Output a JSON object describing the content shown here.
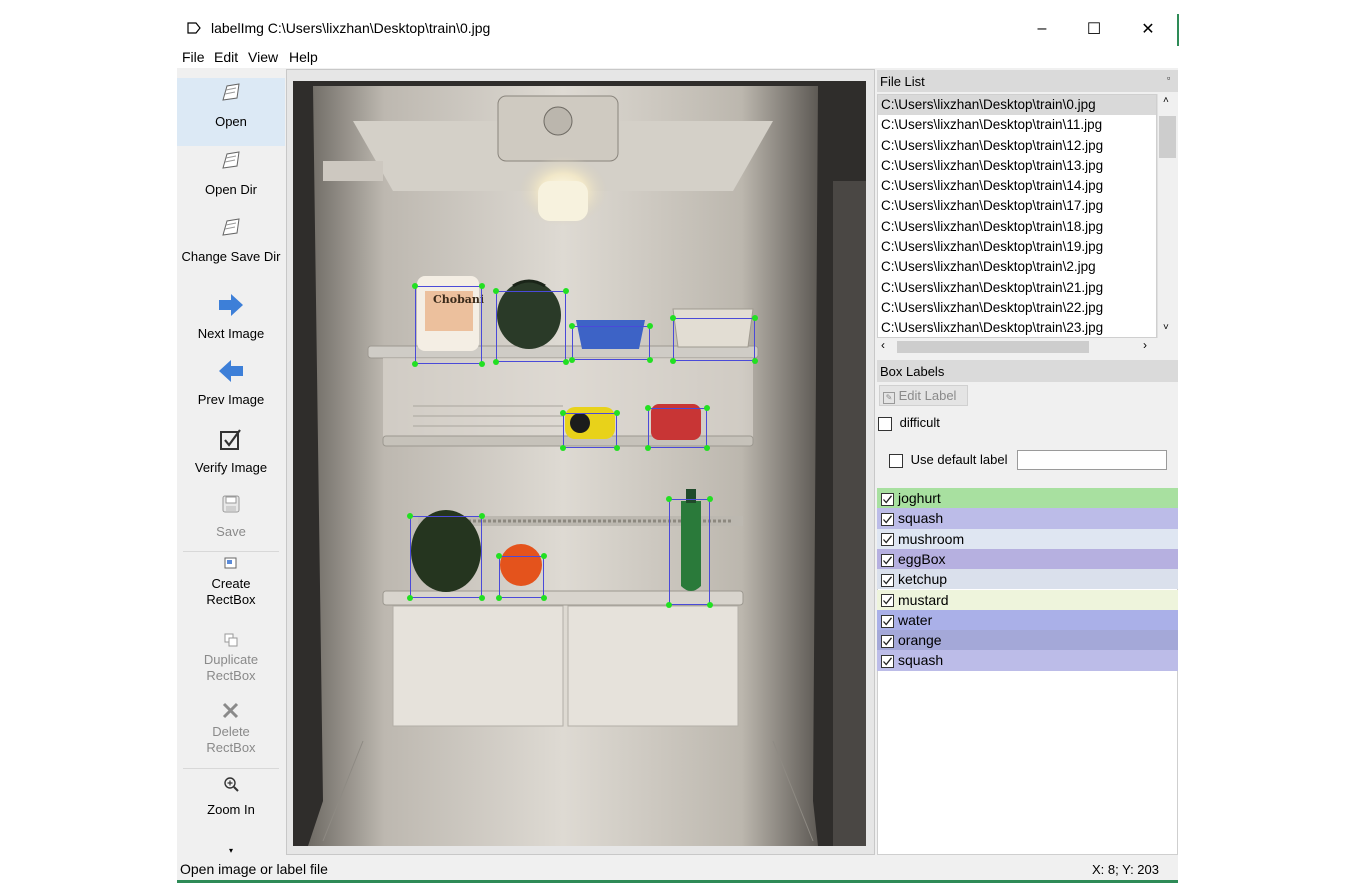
{
  "window": {
    "title": "labelImg C:\\Users\\lixzhan\\Desktop\\train\\0.jpg",
    "minimize_glyph": "–",
    "maximize_glyph": "☐",
    "close_glyph": "✕"
  },
  "menu": {
    "file": "File",
    "edit": "Edit",
    "view": "View",
    "help": "Help"
  },
  "toolbar": {
    "open": "Open",
    "open_dir": "Open Dir",
    "change_save_dir": "Change Save Dir",
    "next_image": "Next Image",
    "prev_image": "Prev Image",
    "verify_image": "Verify Image",
    "save": "Save",
    "create_rectbox_1": "Create",
    "create_rectbox_2": "RectBox",
    "duplicate_rectbox_1": "Duplicate",
    "duplicate_rectbox_2": "RectBox",
    "delete_rectbox_1": "Delete",
    "delete_rectbox_2": "RectBox",
    "zoom_in": "Zoom In"
  },
  "file_list": {
    "title": "File List",
    "items": [
      "C:\\Users\\lixzhan\\Desktop\\train\\0.jpg",
      "C:\\Users\\lixzhan\\Desktop\\train\\11.jpg",
      "C:\\Users\\lixzhan\\Desktop\\train\\12.jpg",
      "C:\\Users\\lixzhan\\Desktop\\train\\13.jpg",
      "C:\\Users\\lixzhan\\Desktop\\train\\14.jpg",
      "C:\\Users\\lixzhan\\Desktop\\train\\17.jpg",
      "C:\\Users\\lixzhan\\Desktop\\train\\18.jpg",
      "C:\\Users\\lixzhan\\Desktop\\train\\19.jpg",
      "C:\\Users\\lixzhan\\Desktop\\train\\2.jpg",
      "C:\\Users\\lixzhan\\Desktop\\train\\21.jpg",
      "C:\\Users\\lixzhan\\Desktop\\train\\22.jpg",
      "C:\\Users\\lixzhan\\Desktop\\train\\23.jpg"
    ],
    "selected_index": 0
  },
  "box_labels": {
    "title": "Box Labels",
    "edit_label": "Edit Label",
    "difficult": "difficult",
    "use_default_label": "Use default label",
    "default_label_value": "",
    "labels": [
      {
        "name": "joghurt",
        "checked": true,
        "color": "#a8e0a0"
      },
      {
        "name": "squash",
        "checked": true,
        "color": "#bcbce8"
      },
      {
        "name": "mushroom",
        "checked": true,
        "color": "#dfe6f2"
      },
      {
        "name": "eggBox",
        "checked": true,
        "color": "#b6b0e0"
      },
      {
        "name": "ketchup",
        "checked": true,
        "color": "#dae0ec"
      },
      {
        "name": "mustard",
        "checked": true,
        "color": "#eef4dc"
      },
      {
        "name": "water",
        "checked": true,
        "color": "#aab0e8"
      },
      {
        "name": "orange",
        "checked": true,
        "color": "#a4a8d8"
      },
      {
        "name": "squash",
        "checked": true,
        "color": "#bcbce8"
      }
    ]
  },
  "image": {
    "product_label": "Chobani"
  },
  "status": {
    "message": "Open image or label file",
    "coords": "X: 8; Y: 203"
  }
}
